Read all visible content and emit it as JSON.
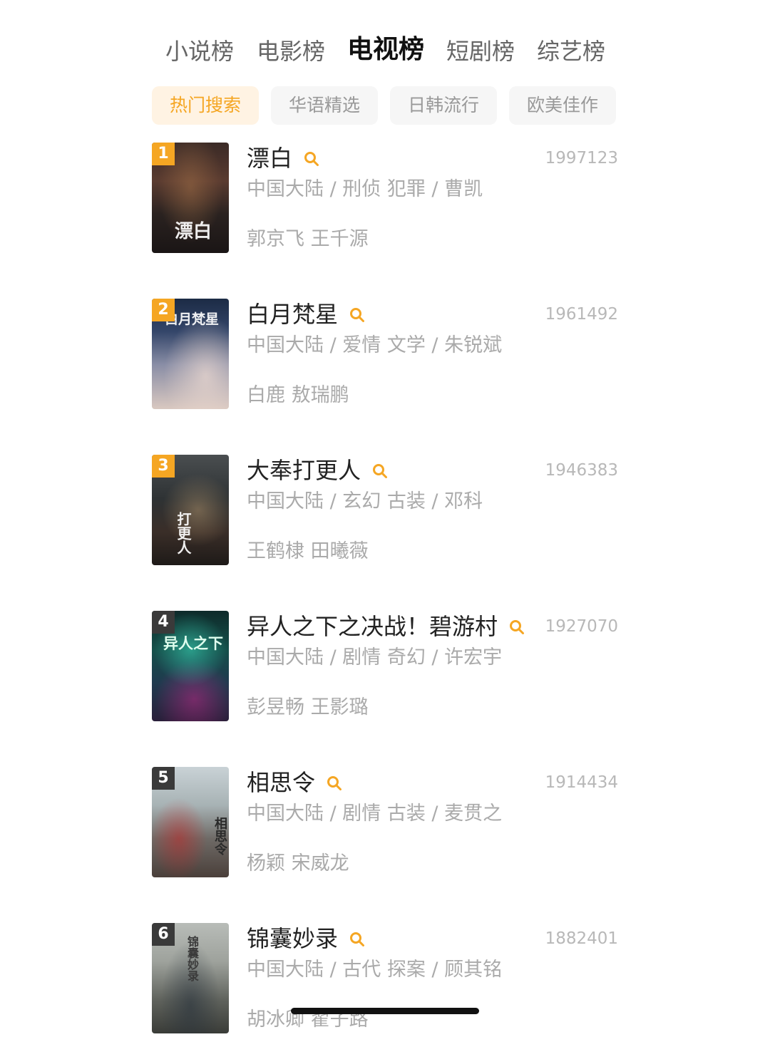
{
  "top_tabs": [
    {
      "label": "小说榜"
    },
    {
      "label": "电影榜"
    },
    {
      "label": "电视榜"
    },
    {
      "label": "短剧榜"
    },
    {
      "label": "综艺榜"
    }
  ],
  "active_top_tab": "电视榜",
  "sub_tabs": [
    {
      "label": "热门搜索"
    },
    {
      "label": "华语精选"
    },
    {
      "label": "日韩流行"
    },
    {
      "label": "欧美佳作"
    }
  ],
  "active_sub_tab": "热门搜索",
  "colors": {
    "accent": "#f5a623",
    "rank_top3": "#f5a623",
    "rank_other": "#3a3a3a"
  },
  "list": [
    {
      "rank": "1",
      "title": "漂白",
      "info": "中国大陆 / 刑侦 犯罪 / 曹凯",
      "cast": "郭京飞 王千源",
      "score": "1997123",
      "poster_text": "漂白"
    },
    {
      "rank": "2",
      "title": "白月梵星",
      "info": "中国大陆 / 爱情 文学 / 朱锐斌",
      "cast": "白鹿 敖瑞鹏",
      "score": "1961492",
      "poster_text": "白月梵星"
    },
    {
      "rank": "3",
      "title": "大奉打更人",
      "info": "中国大陆 / 玄幻 古装 / 邓科",
      "cast": "王鹤棣 田曦薇",
      "score": "1946383",
      "poster_text": "打更人"
    },
    {
      "rank": "4",
      "title": "异人之下之决战！碧游村",
      "info": "中国大陆 / 剧情 奇幻 / 许宏宇",
      "cast": "彭昱畅 王影璐",
      "score": "1927070",
      "poster_text": "异人之下"
    },
    {
      "rank": "5",
      "title": "相思令",
      "info": "中国大陆 / 剧情 古装 / 麦贯之",
      "cast": "杨颖 宋威龙",
      "score": "1914434",
      "poster_text": "相思令"
    },
    {
      "rank": "6",
      "title": "锦囊妙录",
      "info": "中国大陆 / 古代 探案 / 顾其铭",
      "cast": "胡冰卿 翟子路",
      "score": "1882401",
      "poster_text": "锦囊妙录"
    }
  ]
}
